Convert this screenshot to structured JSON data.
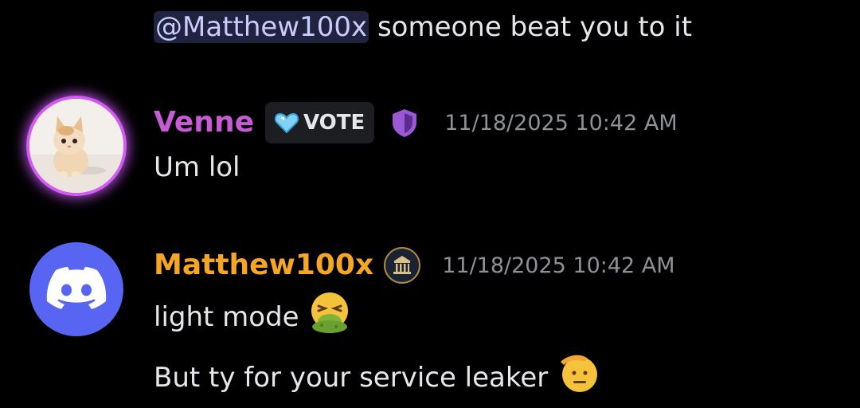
{
  "messages": {
    "prev": {
      "mention": "@Matthew100x",
      "text": "someone beat you to it"
    },
    "venne": {
      "username": "Venne",
      "username_color": "#c95ad6",
      "tag_label": "VOTE",
      "timestamp": "11/18/2025 10:42 AM",
      "text": "Um lol"
    },
    "matthew": {
      "username": "Matthew100x",
      "username_color": "#f5a623",
      "timestamp": "11/18/2025 10:42 AM",
      "line1": "light mode",
      "line2": "But ty for your service leaker"
    }
  },
  "icons": {
    "venne_avatar": "cat-avatar",
    "tag_icon": "blue-heart-icon",
    "role_badge": "purple-shield-icon",
    "matthew_avatar": "discord-logo-avatar",
    "matthew_badge": "bank-building-badge-icon",
    "emoji1": "vomiting-face-emoji",
    "emoji2": "saluting-face-emoji"
  }
}
